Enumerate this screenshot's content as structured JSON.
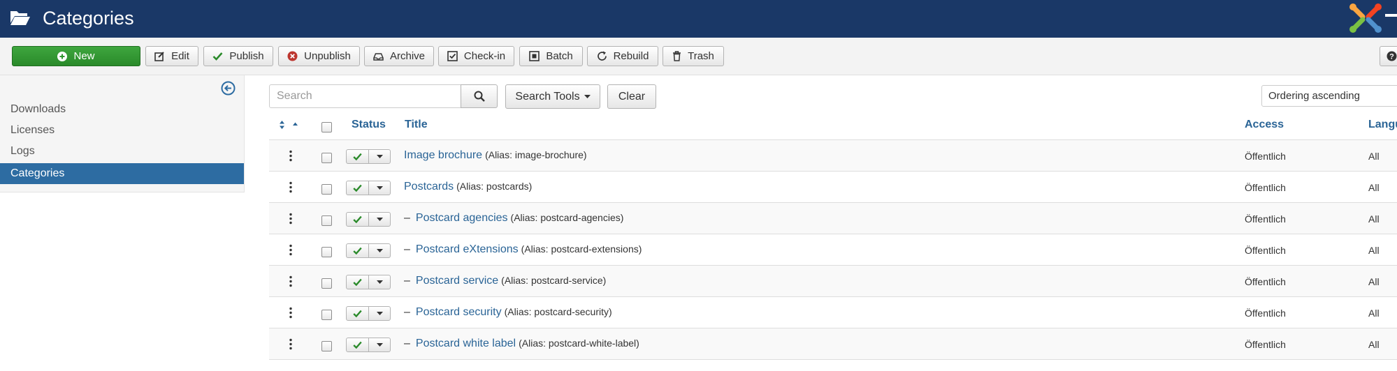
{
  "header": {
    "title": "Categories",
    "icon": "folder-open-icon",
    "logo": "joomla-logo",
    "color": "#1a3867"
  },
  "toolbar": {
    "new_label": "New",
    "edit_label": "Edit",
    "publish_label": "Publish",
    "unpublish_label": "Unpublish",
    "archive_label": "Archive",
    "checkin_label": "Check-in",
    "batch_label": "Batch",
    "rebuild_label": "Rebuild",
    "trash_label": "Trash",
    "help_icon": "help-icon"
  },
  "sidebar": {
    "items": [
      {
        "label": "Downloads"
      },
      {
        "label": "Licenses"
      },
      {
        "label": "Logs"
      },
      {
        "label": "Categories",
        "active": true
      }
    ]
  },
  "filters": {
    "search_placeholder": "Search",
    "search_value": "",
    "search_tools_label": "Search Tools",
    "clear_label": "Clear",
    "ordering_value": "Ordering ascending"
  },
  "table": {
    "columns": {
      "status": "Status",
      "title": "Title",
      "access": "Access",
      "language": "Langu"
    },
    "rows": [
      {
        "title": "Image brochure",
        "alias": "(Alias: image-brochure)",
        "level": 1,
        "access": "Öffentlich",
        "language": "All",
        "dash": ""
      },
      {
        "title": "Postcards",
        "alias": "(Alias: postcards)",
        "level": 1,
        "access": "Öffentlich",
        "language": "All",
        "dash": ""
      },
      {
        "title": "Postcard agencies",
        "alias": "(Alias: postcard-agencies)",
        "level": 2,
        "access": "Öffentlich",
        "language": "All",
        "dash": "–"
      },
      {
        "title": "Postcard eXtensions",
        "alias": "(Alias: postcard-extensions)",
        "level": 2,
        "access": "Öffentlich",
        "language": "All",
        "dash": "–"
      },
      {
        "title": "Postcard service",
        "alias": "(Alias: postcard-service)",
        "level": 2,
        "access": "Öffentlich",
        "language": "All",
        "dash": "–"
      },
      {
        "title": "Postcard security",
        "alias": "(Alias: postcard-security)",
        "level": 2,
        "access": "Öffentlich",
        "language": "All",
        "dash": "–"
      },
      {
        "title": "Postcard white label",
        "alias": "(Alias: postcard-white-label)",
        "level": 2,
        "access": "Öffentlich",
        "language": "All",
        "dash": "–"
      }
    ]
  },
  "colors": {
    "accent": "#2d6ca2",
    "link": "#2a6496",
    "new_button": "#2f962f",
    "published_check": "#2a8a2a"
  }
}
